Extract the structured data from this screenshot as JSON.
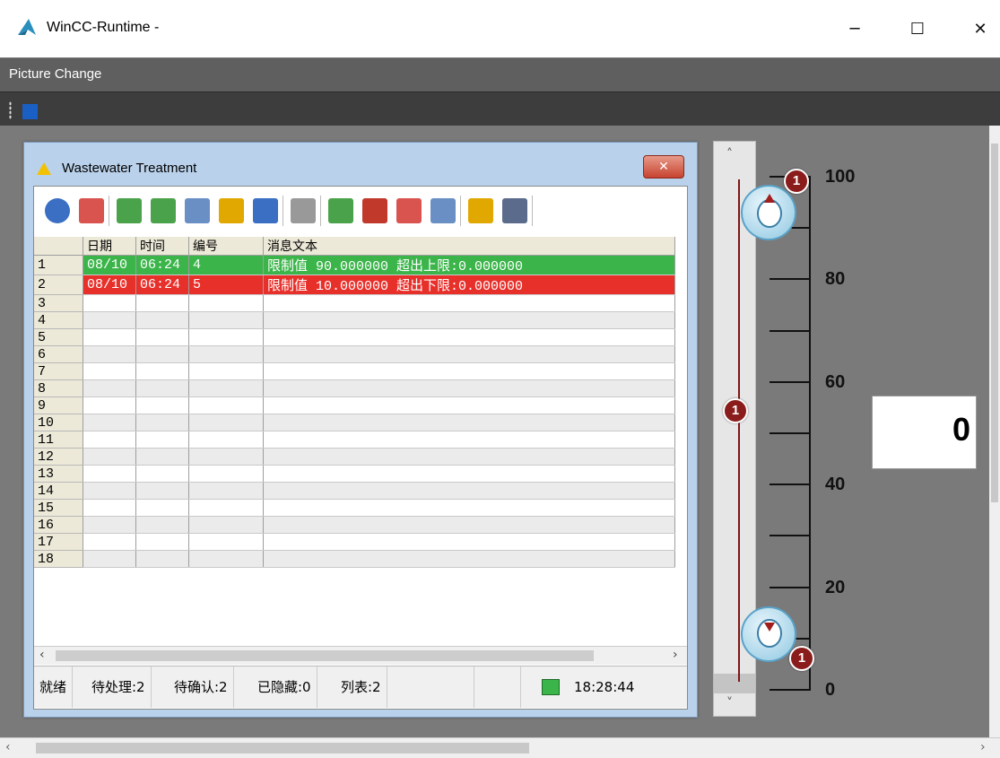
{
  "window": {
    "title": "WinCC-Runtime -"
  },
  "menubar": {
    "items": [
      "Picture Change"
    ]
  },
  "dialog": {
    "title": "Wastewater Treatment",
    "close_glyph": "✕",
    "columns": [
      "日期",
      "时间",
      "编号",
      "消息文本"
    ],
    "rows": [
      {
        "n": "1",
        "date": "08/10",
        "time": "06:24",
        "num": "4",
        "text": "限制值 90.000000 超出上限:0.000000",
        "state": "green"
      },
      {
        "n": "2",
        "date": "08/10",
        "time": "06:24",
        "num": "5",
        "text": "限制值 10.000000 超出下限:0.000000",
        "state": "red"
      },
      {
        "n": "3"
      },
      {
        "n": "4"
      },
      {
        "n": "5"
      },
      {
        "n": "6"
      },
      {
        "n": "7"
      },
      {
        "n": "8"
      },
      {
        "n": "9"
      },
      {
        "n": "10"
      },
      {
        "n": "11"
      },
      {
        "n": "12"
      },
      {
        "n": "13"
      },
      {
        "n": "14"
      },
      {
        "n": "15"
      },
      {
        "n": "16"
      },
      {
        "n": "17"
      },
      {
        "n": "18"
      }
    ],
    "status": {
      "ready": "就绪",
      "pending": "待处理:2",
      "to_ack": "待确认:2",
      "hidden": "已隐藏:0",
      "list": "列表:2",
      "time": "18:28:44"
    },
    "toolbar_icons": [
      "help-icon",
      "selection-dialog-icon",
      "message-list-icon",
      "short-term-archive-icon",
      "long-term-archive-icon",
      "lock-list-icon",
      "hit-list-icon",
      "lock-icon",
      "acknowledge-single-icon",
      "acknowledge-group-icon",
      "emergency-ack-icon",
      "first-message-icon",
      "last-message-icon",
      "print-icon"
    ]
  },
  "scale": {
    "labels": [
      "100",
      "80",
      "60",
      "40",
      "20",
      "0"
    ],
    "value": "0"
  },
  "annotations": {
    "badge": "1"
  },
  "colors": {
    "green": "#3bb54a",
    "red": "#e8302b",
    "annotation": "#8a1c1c"
  }
}
